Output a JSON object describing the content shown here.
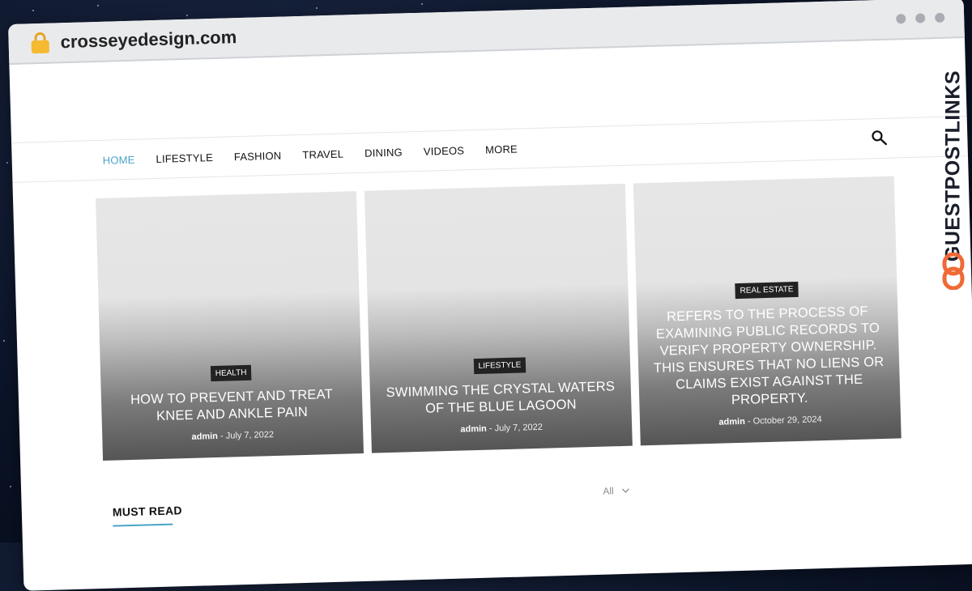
{
  "browser": {
    "url": "crosseyedesign.com"
  },
  "nav": {
    "items": [
      "HOME",
      "LIFESTYLE",
      "FASHION",
      "TRAVEL",
      "DINING",
      "VIDEOS",
      "MORE"
    ]
  },
  "cards": [
    {
      "category": "HEALTH",
      "title": "HOW TO PREVENT AND TREAT KNEE AND ANKLE PAIN",
      "author": "admin",
      "separator": "-",
      "date": "July 7, 2022"
    },
    {
      "category": "LIFESTYLE",
      "title": "SWIMMING THE CRYSTAL WATERS OF THE BLUE LAGOON",
      "author": "admin",
      "separator": "-",
      "date": "July 7, 2022"
    },
    {
      "category": "REAL ESTATE",
      "title": "REFERS TO THE PROCESS OF EXAMINING PUBLIC RECORDS TO VERIFY PROPERTY OWNERSHIP. THIS ENSURES THAT NO LIENS OR CLAIMS EXIST AGAINST THE PROPERTY.",
      "author": "admin",
      "separator": "-",
      "date": "October 29, 2024"
    }
  ],
  "section": {
    "label": "MUST READ",
    "filter": "All"
  },
  "watermark": {
    "text": "GUESTPOSTLINKS"
  },
  "colors": {
    "accent": "#4aa3c7",
    "lock": "#f5b932",
    "brand_icon": "#f06a35"
  },
  "icons": [
    "lock-icon",
    "search-icon",
    "chevron-down-icon",
    "chain-link-icon"
  ]
}
